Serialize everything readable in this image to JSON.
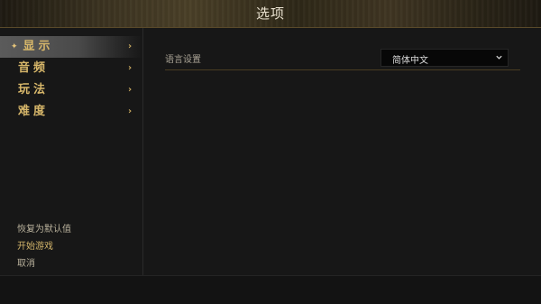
{
  "title": "选项",
  "sidebar": {
    "items": [
      {
        "label": "显示",
        "active": true
      },
      {
        "label": "音频",
        "active": false
      },
      {
        "label": "玩法",
        "active": false
      },
      {
        "label": "难度",
        "active": false
      }
    ],
    "bullet_glyph": "✦",
    "chevron_glyph": "›",
    "bottom": {
      "restore_defaults": "恢复为默认值",
      "start_game": "开始游戏",
      "cancel": "取消"
    }
  },
  "content": {
    "language": {
      "label": "语言设置",
      "value": "简体中文"
    }
  },
  "colors": {
    "accent_gold": "#d7b76a",
    "background": "#171717",
    "select_bg": "#070707"
  }
}
